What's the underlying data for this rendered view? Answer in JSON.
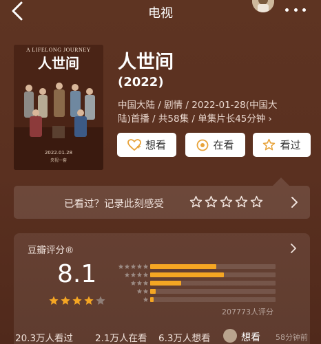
{
  "header": {
    "title": "电视"
  },
  "poster": {
    "banner": "A LIFELONG JOURNEY",
    "title_mark": "人世间",
    "date_line": "2022.01.28",
    "channel": "央视一套"
  },
  "show": {
    "title": "人世间",
    "year": "(2022)",
    "meta": "中国大陆 / 剧情 / 2022-01-28(中国大陆)首播 / 共58集 / 单集片长45分钟",
    "meta_chevron": "›"
  },
  "actions": {
    "want": "想看",
    "watching": "在看",
    "watched": "看过"
  },
  "record": {
    "prompt": "已看过？记录此刻感受",
    "stars": 5
  },
  "rating": {
    "label": "豆瓣评分®",
    "score": "8.1",
    "stars_filled": 4,
    "stars_total": 5,
    "count_text": "207773人评分",
    "distribution": [
      {
        "stars": 5,
        "fraction": 0.36
      },
      {
        "stars": 4,
        "fraction": 0.4
      },
      {
        "stars": 3,
        "fraction": 0.17
      },
      {
        "stars": 2,
        "fraction": 0.03
      },
      {
        "stars": 1,
        "fraction": 0.02
      }
    ]
  },
  "stats": {
    "watched": "20.3万人看过",
    "watching": "2.1万人在看",
    "want": "6.3万人想看"
  },
  "latest_comment": {
    "verb": "想看",
    "time": "58分钟前"
  },
  "colors": {
    "background": "#5a3020",
    "star": "#f5a623",
    "bar_fill": "#f5a623",
    "button_bg": "#ffffff",
    "icon_accent": "#e8a33a"
  }
}
